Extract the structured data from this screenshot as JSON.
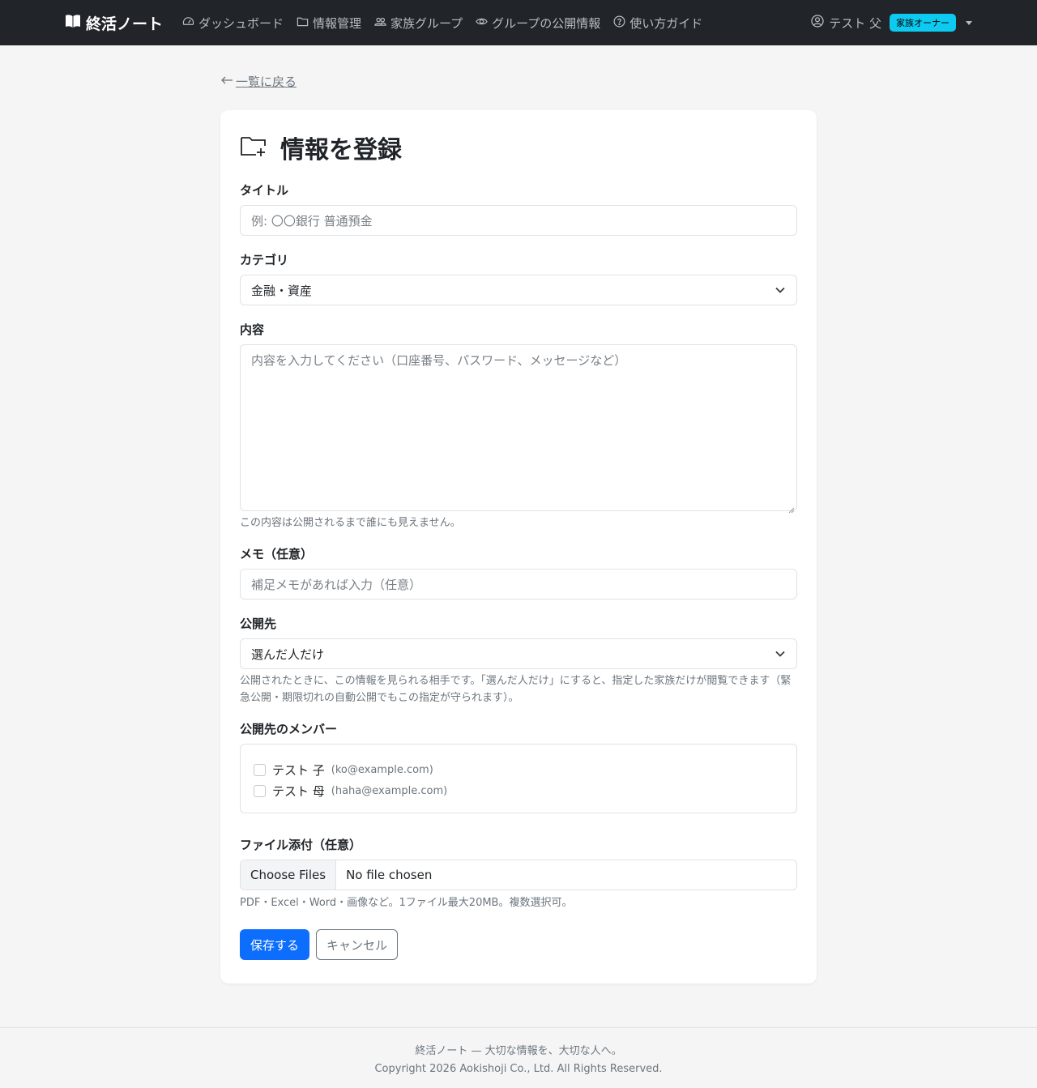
{
  "nav": {
    "brand": "終活ノート",
    "links": [
      {
        "label": "ダッシュボード",
        "icon": "speedometer-icon"
      },
      {
        "label": "情報管理",
        "icon": "folder-icon"
      },
      {
        "label": "家族グループ",
        "icon": "people-icon"
      },
      {
        "label": "グループの公開情報",
        "icon": "eye-icon"
      },
      {
        "label": "使い方ガイド",
        "icon": "question-circle-icon"
      }
    ],
    "user_name": "テスト 父",
    "user_badge": "家族オーナー"
  },
  "back_link": "一覧に戻る",
  "page_title": "情報を登録",
  "form": {
    "title_label": "タイトル",
    "title_placeholder": "例: 〇〇銀行 普通預金",
    "category_label": "カテゴリ",
    "category_value": "金融・資産",
    "content_label": "内容",
    "content_placeholder": "内容を入力してください（口座番号、パスワード、メッセージなど）",
    "content_help": "この内容は公開されるまで誰にも見えません。",
    "memo_label": "メモ（任意）",
    "memo_placeholder": "補足メモがあれば入力（任意）",
    "visibility_label": "公開先",
    "visibility_value": "選んだ人だけ",
    "visibility_help": "公開されたときに、この情報を見られる相手です。「選んだ人だけ」にすると、指定した家族だけが閲覧できます（緊急公開・期限切れの自動公開でもこの指定が守られます）。",
    "members_label": "公開先のメンバー",
    "members": [
      {
        "name": "テスト 子",
        "email": "(ko@example.com)"
      },
      {
        "name": "テスト 母",
        "email": "(haha@example.com)"
      }
    ],
    "file_label": "ファイル添付（任意）",
    "file_button": "Choose Files",
    "file_status": "No file chosen",
    "file_help": "PDF・Excel・Word・画像など。1ファイル最大20MB。複数選択可。",
    "save_label": "保存する",
    "cancel_label": "キャンセル"
  },
  "footer": {
    "tagline": "終活ノート — 大切な情報を、大切な人へ。",
    "copyright": "Copyright 2026 Aokishoji Co., Ltd. All Rights Reserved."
  },
  "colors": {
    "navbar": "#212529",
    "primary": "#0d6efd",
    "badge": "#0dcaf0",
    "background": "#f5f5f6"
  }
}
